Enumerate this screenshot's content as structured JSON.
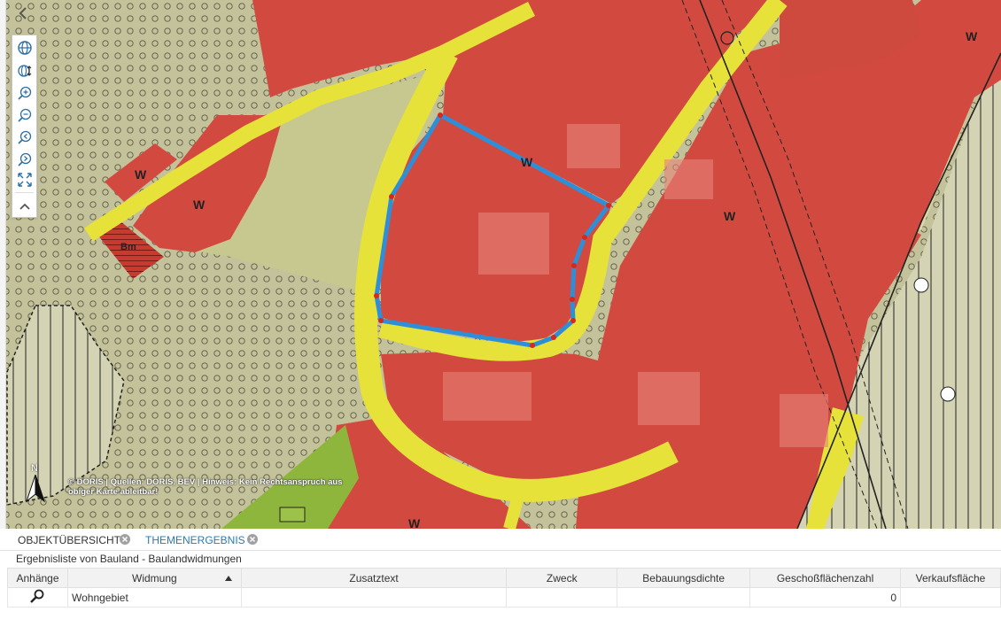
{
  "map": {
    "labels": [
      "W",
      "W",
      "W",
      "W",
      "W",
      "W",
      "Bm"
    ],
    "north_label": "N",
    "attribution": "© DORIS | Quellen: DORIS, BEV | Hinweis: Kein Rechtsanspruch aus obiger Karte ableitbar!",
    "toolbar_icons": [
      "globe-icon",
      "globe-navigate-icon",
      "zoom-in-icon",
      "zoom-out-icon",
      "zoom-previous-icon",
      "zoom-next-icon",
      "full-extent-icon",
      "chevron-up-icon"
    ],
    "colors": {
      "zoning_red": "#d24a3f",
      "road_yellow": "#e6e23a",
      "green_zone": "#8eb63c",
      "selection_outline": "#2e8fd8"
    }
  },
  "panel": {
    "tabs": [
      {
        "label": "OBJEKTÜBERSICHT",
        "active": false
      },
      {
        "label": "THEMENERGEBNIS",
        "active": true
      }
    ],
    "subtitle": "Ergebnisliste von Bauland - Baulandwidmungen",
    "columns": [
      "Anhänge",
      "Widmung",
      "Zusatztext",
      "Zweck",
      "Bebauungsdichte",
      "Geschoßflächenzahl",
      "Verkaufsfläche"
    ],
    "sort_column": "Widmung",
    "rows": [
      {
        "anhaenge_icon": "magnifier-icon",
        "widmung": "Wohngebiet",
        "zusatztext": "",
        "zweck": "",
        "bebauungsdichte": "",
        "geschossflaechenzahl": "0",
        "verkaufsflaeche": ""
      }
    ]
  }
}
